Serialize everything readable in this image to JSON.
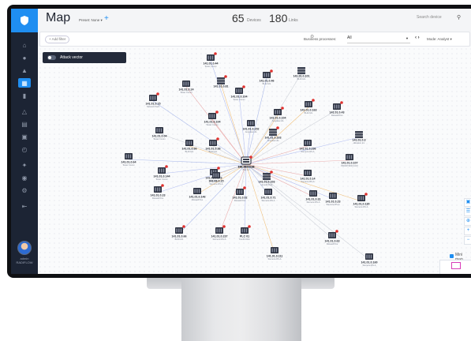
{
  "header": {
    "title": "Map",
    "preset_label": "Preset: None ▾",
    "add_label": "+",
    "devices_count": "65",
    "devices_label": "Devices",
    "links_count": "180",
    "links_label": "Links",
    "search_placeholder": "Search device"
  },
  "filter_bar": {
    "add_filter": "+ Add filter",
    "business_processes_label": "Business processes:",
    "business_processes_value": "All",
    "mode_label": "Mode: Analyst ▾"
  },
  "attack_vector_label": "Attack vector",
  "minimap_label": "Mini map",
  "sidebar": {
    "user_name": "admin",
    "user_role": "RADIFLOW"
  },
  "colors": {
    "accent": "#1f8ef1",
    "sidebar": "#1c2434",
    "alert": "#e0322f"
  },
  "nodes": [
    {
      "ip": "141.01.0.44",
      "desc": "Tower Comm",
      "kind": "plc",
      "alert": true
    },
    {
      "ip": "141.01.0.81",
      "desc": "",
      "kind": "switch",
      "alert": true
    },
    {
      "ip": "141.01.0.101",
      "desc": "BL40 HG",
      "kind": "switch",
      "alert": false
    },
    {
      "ip": "141.01.0.46",
      "desc": "BL42 HG",
      "kind": "plc",
      "alert": true
    },
    {
      "ip": "141.01.0.24",
      "desc": "Tower Comm",
      "kind": "plc",
      "alert": false
    },
    {
      "ip": "141.01.0.104",
      "desc": "Tower Comm",
      "kind": "plc",
      "alert": true
    },
    {
      "ip": "141.01.0.163",
      "desc": "BL42 HG",
      "kind": "plc",
      "alert": true
    },
    {
      "ip": "141.01.0.43",
      "desc": "Roswell Pos",
      "kind": "plc",
      "alert": true
    },
    {
      "ip": "141.01.0.15",
      "desc": "Network Pack",
      "kind": "plc",
      "alert": true
    },
    {
      "ip": "141.01.0.104",
      "desc": "Tower Comm",
      "kind": "plc",
      "alert": true
    },
    {
      "ip": "141.01.0.152",
      "desc": "Jungalas HG",
      "kind": "plc",
      "alert": false
    },
    {
      "ip": "141.01.0.104",
      "desc": "Jungalas HG",
      "kind": "plc",
      "alert": true
    },
    {
      "ip": "141.01.0.04",
      "desc": "Tower Comm",
      "kind": "plc",
      "alert": false
    },
    {
      "ip": "141.01.0.163",
      "desc": "Jungalas HG",
      "kind": "switch",
      "alert": true
    },
    {
      "ip": "141.01.0.236",
      "desc": "Siemens RS-A",
      "kind": "plc",
      "alert": false
    },
    {
      "ip": "141.01.0.3",
      "desc": "Hikvision Inc",
      "kind": "switch",
      "alert": false
    },
    {
      "ip": "141.01.0.66",
      "desc": "BL40 HG",
      "kind": "plc",
      "alert": false
    },
    {
      "ip": "141.01.0.36",
      "desc": "BL42 HG",
      "kind": "plc",
      "alert": true
    },
    {
      "ip": "141.01.0.64",
      "desc": "Tower Comm",
      "kind": "plc",
      "alert": false
    },
    {
      "ip": "141.01.0.107",
      "desc": "PROFITRON COX",
      "kind": "plc",
      "alert": false
    },
    {
      "ip": "141.01.0.144",
      "desc": "Tower Comm",
      "kind": "plc",
      "alert": true
    },
    {
      "ip": "141.01.0.143",
      "desc": "BL40 HG",
      "kind": "plc",
      "alert": true
    },
    {
      "ip": "141.01.0.15",
      "desc": "Siemens RS-A",
      "kind": "plc",
      "alert": false
    },
    {
      "ip": "141.01.0.103",
      "desc": "Honold Pack",
      "kind": "switch",
      "alert": true
    },
    {
      "ip": "141.01.0.14",
      "desc": "Siemens RS-A",
      "kind": "plc",
      "alert": false
    },
    {
      "ip": "141.01.0.23",
      "desc": "Roswell Pos",
      "kind": "plc",
      "alert": true
    },
    {
      "ip": "141.01.0.146",
      "desc": "Roswell Pos",
      "kind": "plc",
      "alert": false
    },
    {
      "ip": "141.01.0.02",
      "desc": "Roswell Pos",
      "kind": "plc",
      "alert": true
    },
    {
      "ip": "141.01.0.71",
      "desc": "Siemens RS-A",
      "kind": "plc",
      "alert": false
    },
    {
      "ip": "141.01.0.31",
      "desc": "Siemens RS-A",
      "kind": "plc",
      "alert": false
    },
    {
      "ip": "141.01.0.23",
      "desc": "Siemens RS-A",
      "kind": "plc",
      "alert": false
    },
    {
      "ip": "141.01.0.130",
      "desc": "Siemens RS-A",
      "kind": "plc",
      "alert": true
    },
    {
      "ip": "141.01.0.63",
      "desc": "Roswell Pos",
      "kind": "plc",
      "alert": true
    },
    {
      "ip": "141.01.0.66",
      "desc": "BL40 HG",
      "kind": "plc",
      "alert": true
    },
    {
      "ip": "141.01.0.237",
      "desc": "Siemens RS-A",
      "kind": "plc",
      "alert": true
    },
    {
      "ip": "PLC 01",
      "desc": "Control Dev",
      "kind": "plc",
      "alert": true
    },
    {
      "ip": "141.01.0.111",
      "desc": "Siemens RS-A",
      "kind": "plc",
      "alert": false
    },
    {
      "ip": "141.01.0.160",
      "desc": "Siemens RS-A",
      "kind": "plc",
      "alert": false
    },
    {
      "ip": "152.160.1.34",
      "desc": "Bad Inc",
      "kind": "router",
      "alert": false
    },
    {
      "ip": "141.01.0.112",
      "desc": "",
      "kind": "hub",
      "alert": true
    }
  ]
}
